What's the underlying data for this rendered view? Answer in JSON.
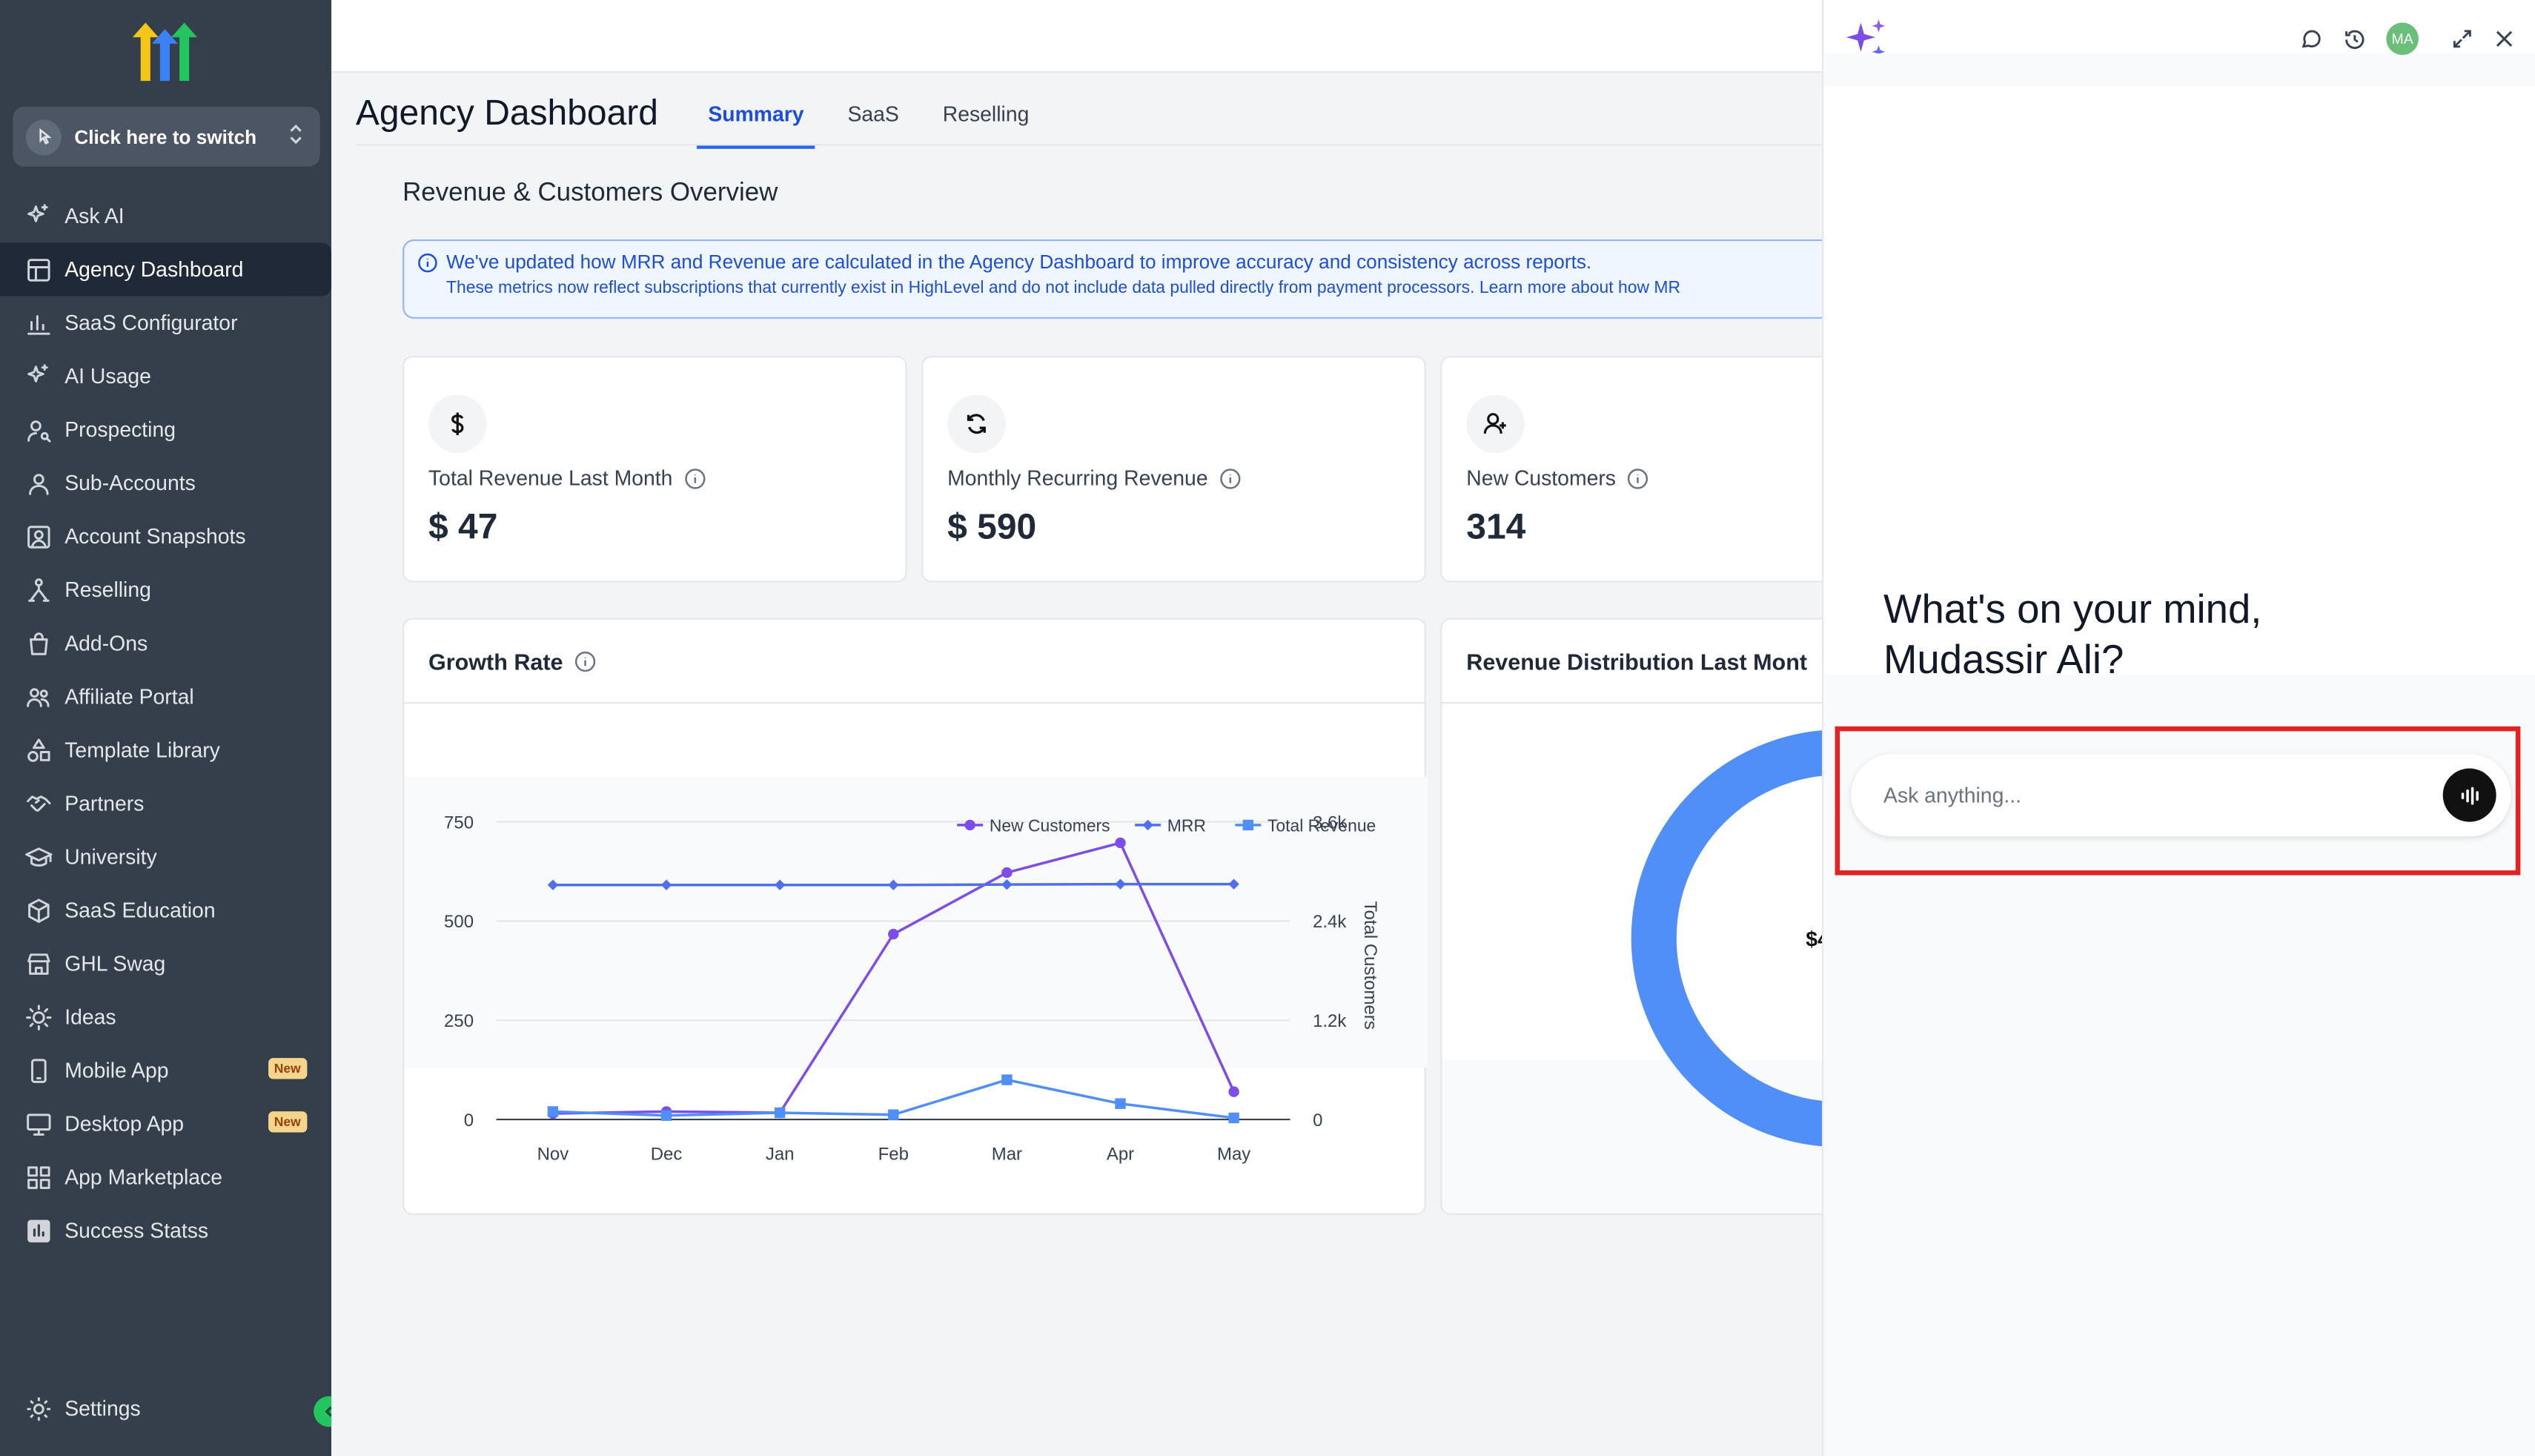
{
  "sidebar": {
    "switcher_label": "Click here to switch",
    "items": [
      {
        "label": "Ask AI",
        "icon": "sparkle-icon"
      },
      {
        "label": "Agency Dashboard",
        "icon": "dashboard-icon"
      },
      {
        "label": "SaaS Configurator",
        "icon": "bar-chart-icon"
      },
      {
        "label": "AI Usage",
        "icon": "sparkle-icon"
      },
      {
        "label": "Prospecting",
        "icon": "user-search-icon"
      },
      {
        "label": "Sub-Accounts",
        "icon": "user-icon"
      },
      {
        "label": "Account Snapshots",
        "icon": "snapshot-icon"
      },
      {
        "label": "Reselling",
        "icon": "reselling-icon"
      },
      {
        "label": "Add-Ons",
        "icon": "bag-icon"
      },
      {
        "label": "Affiliate Portal",
        "icon": "users-icon"
      },
      {
        "label": "Template Library",
        "icon": "shapes-icon"
      },
      {
        "label": "Partners",
        "icon": "handshake-icon"
      },
      {
        "label": "University",
        "icon": "graduation-cap-icon"
      },
      {
        "label": "SaaS Education",
        "icon": "cube-icon"
      },
      {
        "label": "GHL Swag",
        "icon": "store-icon"
      },
      {
        "label": "Ideas",
        "icon": "lightbulb-icon"
      },
      {
        "label": "Mobile App",
        "icon": "mobile-icon",
        "badge": "New"
      },
      {
        "label": "Desktop App",
        "icon": "desktop-icon",
        "badge": "New"
      },
      {
        "label": "App Marketplace",
        "icon": "grid-icon"
      },
      {
        "label": "Success Statss",
        "icon": "stats-icon"
      }
    ],
    "settings_label": "Settings"
  },
  "header": {
    "title": "Agency Dashboard",
    "tabs": [
      "Summary",
      "SaaS",
      "Reselling"
    ],
    "active_tab": "Summary"
  },
  "overview": {
    "title": "Revenue & Customers Overview",
    "banner_line1": "We've updated how MRR and Revenue are calculated in the Agency Dashboard to improve accuracy and consistency across reports.",
    "banner_line2": "These metrics now reflect subscriptions that currently exist in HighLevel and do not include data pulled directly from payment processors. Learn more about how MR"
  },
  "stats": [
    {
      "label": "Total Revenue Last Month",
      "value": "$ 47",
      "icon": "dollar-icon"
    },
    {
      "label": "Monthly Recurring Revenue",
      "value": "$ 590",
      "icon": "refresh-icon"
    },
    {
      "label": "New Customers",
      "value": "314",
      "icon": "user-plus-icon"
    }
  ],
  "growth": {
    "title": "Growth Rate"
  },
  "distribution": {
    "title": "Revenue Distribution Last Mont",
    "center_text": "$4"
  },
  "chart_data": {
    "type": "line",
    "categories": [
      "Nov",
      "Dec",
      "Jan",
      "Feb",
      "Mar",
      "Apr",
      "May"
    ],
    "series": [
      {
        "name": "New Customers",
        "values": [
          15,
          20,
          17,
          467,
          622,
          697,
          70
        ],
        "color": "#7c4de8",
        "marker": "circle"
      },
      {
        "name": "MRR",
        "values": [
          591,
          591,
          591,
          591,
          592,
          593,
          593
        ],
        "color": "#4f6ef0",
        "marker": "diamond"
      },
      {
        "name": "Total Revenue",
        "values": [
          20,
          10,
          17,
          12,
          100,
          40,
          4
        ],
        "color": "#4f8ff7",
        "marker": "square"
      }
    ],
    "ylim": [
      0,
      750
    ],
    "y_ticks": [
      "750",
      "500",
      "250",
      "0"
    ],
    "y2_ticks": [
      "3.6k",
      "2.4k",
      "1.2k",
      "0"
    ],
    "y2label": "Total Customers",
    "legend_position": "top-right"
  },
  "ai": {
    "greeting_line1": "What's on your mind,",
    "greeting_line2": "Mudassir Ali?",
    "placeholder": "Ask anything...",
    "avatar_initials": "MA"
  }
}
